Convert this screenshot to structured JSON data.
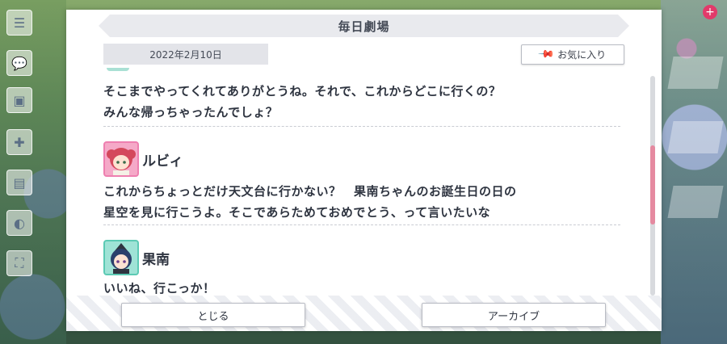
{
  "dialog": {
    "title": "毎日劇場",
    "date": "2022年2月10日",
    "favorite_label": "お気に入り"
  },
  "log": {
    "entries": [
      {
        "speaker": "",
        "lines": [
          "そこまでやってくれてありがとうね。それで、これからどこに行くの？",
          "みんな帰っちゃったんでしょ？"
        ]
      },
      {
        "speaker": "ルビィ",
        "lines": [
          "これからちょっとだけ天文台に行かない？　果南ちゃんのお誕生日の日の",
          "星空を見に行こうよ。そこであらためておめでとう、って言いたいな"
        ]
      },
      {
        "speaker": "果南",
        "lines": [
          "いいね、行こっか！"
        ]
      }
    ]
  },
  "footer": {
    "close_label": "とじる",
    "archive_label": "アーカイブ"
  },
  "colors": {
    "scroll_thumb": "#e58aa0",
    "ruby_frame": "#ee7fb0",
    "kanan_frame": "#5ccab4"
  }
}
